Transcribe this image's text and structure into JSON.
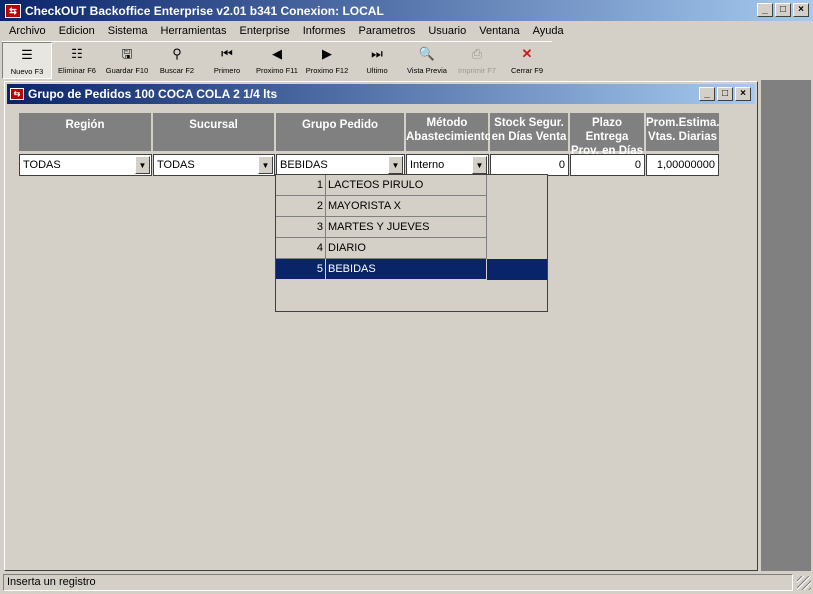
{
  "window": {
    "title": "CheckOUT Backoffice Enterprise v2.01 b341 Conexion: LOCAL"
  },
  "menu": [
    "Archivo",
    "Edicion",
    "Sistema",
    "Herramientas",
    "Enterprise",
    "Informes",
    "Parametros",
    "Usuario",
    "Ventana",
    "Ayuda"
  ],
  "toolbar": [
    {
      "label": "Nuevo F3",
      "icon": "new-record-icon",
      "glyph": "☰",
      "state": "pressed"
    },
    {
      "label": "Eliminar F6",
      "icon": "delete-record-icon",
      "glyph": "☷",
      "state": "normal"
    },
    {
      "label": "Guardar F10",
      "icon": "floppy-save-icon",
      "glyph": "🖫",
      "state": "normal"
    },
    {
      "label": "Buscar F2",
      "icon": "binoculars-icon",
      "glyph": "⚲",
      "state": "normal"
    },
    {
      "label": "Primero",
      "icon": "first-record-icon",
      "glyph": "⏮",
      "state": "normal"
    },
    {
      "label": "Proximo F11",
      "icon": "previous-record-icon",
      "glyph": "◀",
      "state": "normal"
    },
    {
      "label": "Proximo F12",
      "icon": "next-record-icon",
      "glyph": "▶",
      "state": "normal"
    },
    {
      "label": "Ultimo",
      "icon": "last-record-icon",
      "glyph": "⏭",
      "state": "normal"
    },
    {
      "label": "Vista Previa",
      "icon": "print-preview-icon",
      "glyph": "🔍",
      "state": "normal"
    },
    {
      "label": "Imprimir F7",
      "icon": "printer-icon",
      "glyph": "⎙",
      "state": "disabled"
    },
    {
      "label": "Cerrar F9",
      "icon": "close-x-icon",
      "glyph": "✕",
      "state": "normal"
    }
  ],
  "child_window": {
    "title": "Grupo de Pedidos 100 COCA COLA 2 1/4 lts"
  },
  "grid": {
    "headers": [
      {
        "line1": "Región",
        "line2": ""
      },
      {
        "line1": "Sucursal",
        "line2": ""
      },
      {
        "line1": "Grupo Pedido",
        "line2": ""
      },
      {
        "line1": "Método",
        "line2": "Abastecimiento"
      },
      {
        "line1": "Stock Segur.",
        "line2": "en Días Venta"
      },
      {
        "line1": "Plazo Entrega",
        "line2": "Prov. en Días"
      },
      {
        "line1": "Prom.Estima.",
        "line2": "Vtas. Diarias"
      }
    ],
    "row": {
      "region": "TODAS",
      "sucursal": "TODAS",
      "grupo_pedido": "BEBIDAS",
      "metodo": "Interno",
      "stock_seguridad": "0",
      "plazo_entrega": "0",
      "prom_estima": "1,00000000"
    }
  },
  "dropdown": {
    "items": [
      {
        "num": "1",
        "label": "LACTEOS PIRULO"
      },
      {
        "num": "2",
        "label": "MAYORISTA X"
      },
      {
        "num": "3",
        "label": "MARTES Y JUEVES"
      },
      {
        "num": "4",
        "label": "DIARIO"
      },
      {
        "num": "5",
        "label": "BEBIDAS"
      }
    ],
    "selected_index": 4
  },
  "status": {
    "text": "Inserta un registro"
  },
  "colors": {
    "title_start": "#0a246a",
    "title_end": "#a6caf0",
    "header_bg": "#808080",
    "selection": "#0a246a"
  }
}
